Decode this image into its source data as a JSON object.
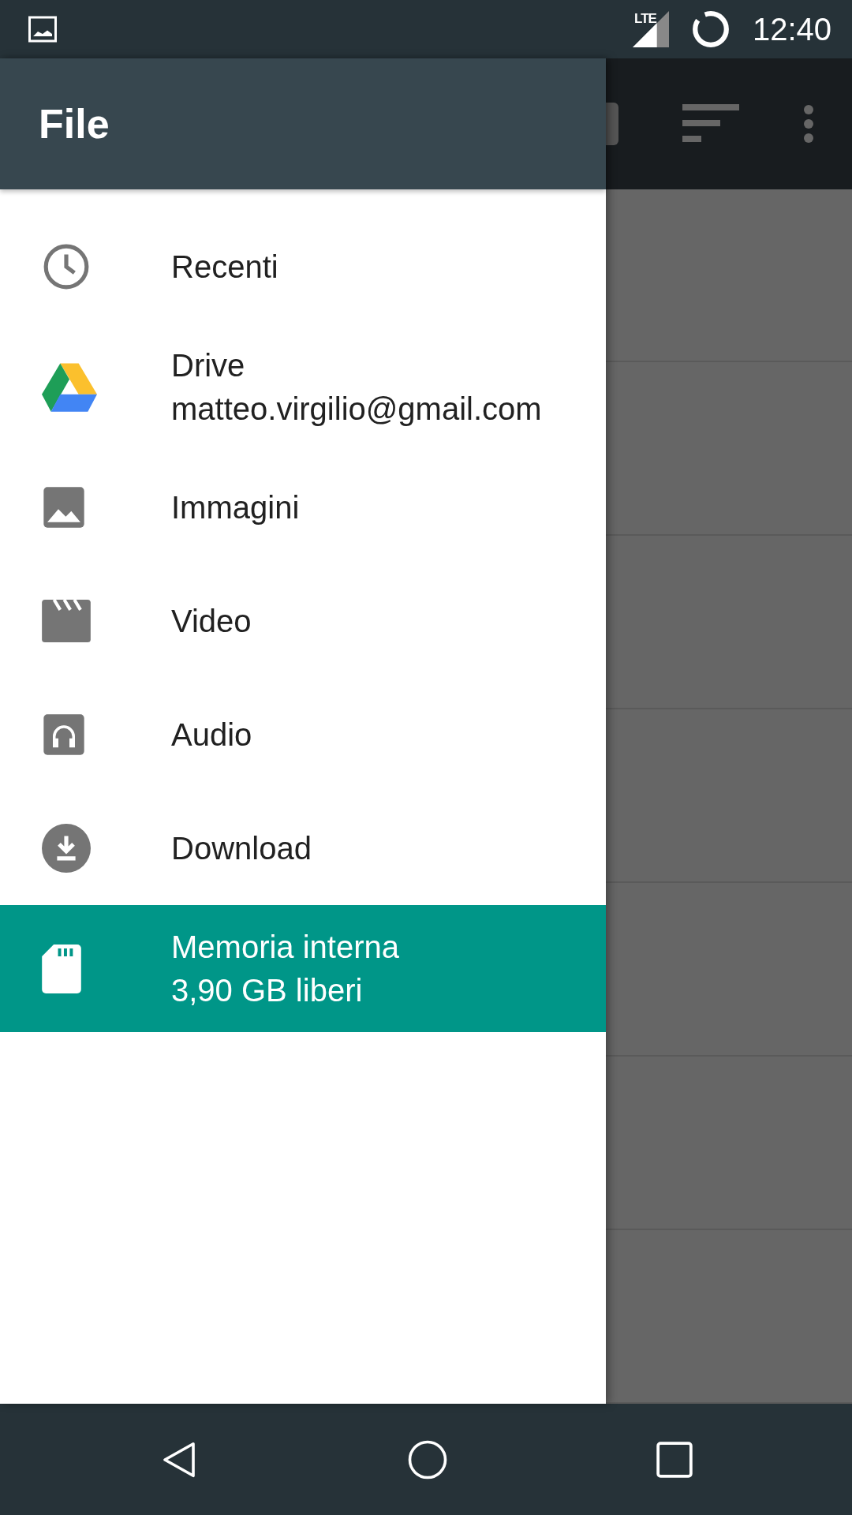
{
  "status_bar": {
    "network": "LTE",
    "time": "12:40"
  },
  "drawer": {
    "title": "File",
    "items": [
      {
        "kind": "clock",
        "label": "Recenti",
        "selected": false
      },
      {
        "kind": "drive",
        "label": "Drive",
        "sublabel": "matteo.virgilio@gmail.com",
        "selected": false
      },
      {
        "kind": "image",
        "label": "Immagini",
        "selected": false
      },
      {
        "kind": "video",
        "label": "Video",
        "selected": false
      },
      {
        "kind": "audio",
        "label": "Audio",
        "selected": false
      },
      {
        "kind": "download",
        "label": "Download",
        "selected": false
      },
      {
        "kind": "sdcard",
        "label": "Memoria interna",
        "sublabel": "3,90 GB liberi",
        "selected": true
      }
    ]
  }
}
